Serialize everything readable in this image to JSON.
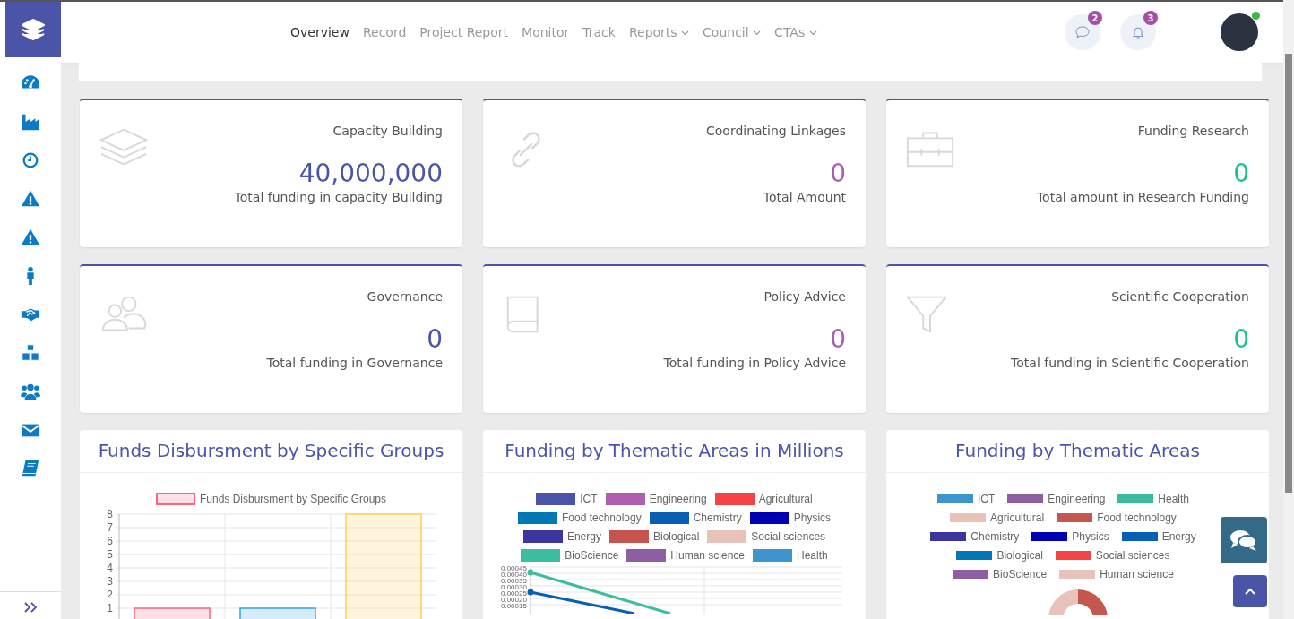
{
  "nav": {
    "items": [
      {
        "label": "Overview",
        "selected": true,
        "dropdown": false
      },
      {
        "label": "Record",
        "selected": false,
        "dropdown": false
      },
      {
        "label": "Project Report",
        "selected": false,
        "dropdown": false
      },
      {
        "label": "Monitor",
        "selected": false,
        "dropdown": false
      },
      {
        "label": "Track",
        "selected": false,
        "dropdown": false
      },
      {
        "label": "Reports",
        "selected": false,
        "dropdown": true
      },
      {
        "label": "Council",
        "selected": false,
        "dropdown": true
      },
      {
        "label": "CTAs",
        "selected": false,
        "dropdown": true
      }
    ],
    "messages_count": "2",
    "notifications_count": "3",
    "user_online": true
  },
  "sidebar": {
    "items": [
      {
        "kind": "gauge"
      },
      {
        "kind": "factory"
      },
      {
        "kind": "clock"
      },
      {
        "kind": "warning"
      },
      {
        "kind": "warning"
      },
      {
        "kind": "person"
      },
      {
        "kind": "handshake"
      },
      {
        "kind": "cubes"
      },
      {
        "kind": "users"
      },
      {
        "kind": "envelope"
      },
      {
        "kind": "book"
      }
    ]
  },
  "stats": [
    {
      "kind": "layers",
      "title": "Capacity Building",
      "value": "40,000,000",
      "caption": "Total funding in capacity Building",
      "color": "#4a55a8"
    },
    {
      "kind": "link",
      "title": "Coordinating Linkages",
      "value": "0",
      "caption": "Total Amount",
      "color": "#a95bb5"
    },
    {
      "kind": "briefcase",
      "title": "Funding Research",
      "value": "0",
      "caption": "Total amount in Research Funding",
      "color": "#1cbf8a"
    },
    {
      "kind": "users",
      "title": "Governance",
      "value": "0",
      "caption": "Total funding in Governance",
      "color": "#4a55a8"
    },
    {
      "kind": "book",
      "title": "Policy Advice",
      "value": "0",
      "caption": "Total funding in Policy Advice",
      "color": "#a95bb5"
    },
    {
      "kind": "funnel",
      "title": "Scientific Cooperation",
      "value": "0",
      "caption": "Total funding in Scientific Cooperation",
      "color": "#1cbf8a"
    }
  ],
  "charts": [
    {
      "kind": "bar",
      "title": "Funds Disbursment by Specific Groups",
      "chart_data": {
        "type": "bar",
        "yticks": [
          1,
          2,
          3,
          4,
          5,
          6,
          7,
          8
        ],
        "ylim": [
          0,
          8
        ],
        "grid": true,
        "series": [
          {
            "name": "Funds Disbursment by Specific Groups",
            "color": "#ff6384",
            "colors": [
              "#ff6384",
              "#36a2eb",
              "#ffce56"
            ],
            "values": [
              1,
              1,
              8
            ]
          }
        ]
      }
    },
    {
      "kind": "line",
      "title": "Funding by Thematic Areas in Millions",
      "legend": [
        {
          "label": "ICT",
          "color": "#4a55a8"
        },
        {
          "label": "Engineering",
          "color": "#b05fb0"
        },
        {
          "label": "Agricultural",
          "color": "#f54444"
        },
        {
          "label": "Food technology",
          "color": "#0277b5"
        },
        {
          "label": "Chemistry",
          "color": "#085fb3"
        },
        {
          "label": "Physics",
          "color": "#0000b3"
        },
        {
          "label": "Energy",
          "color": "#3c35a0"
        },
        {
          "label": "Biological",
          "color": "#c5544f"
        },
        {
          "label": "Social sciences",
          "color": "#e8c3b9"
        },
        {
          "label": "BioScience",
          "color": "#3bbd9f"
        },
        {
          "label": "Human science",
          "color": "#8e5ea2"
        },
        {
          "label": "Health",
          "color": "#3e95cd"
        }
      ],
      "y_axis_labels": [
        "0.00045",
        "0.00040",
        "0.00035",
        "0.00030",
        "0.00025",
        "0.00020",
        "0.00015"
      ]
    },
    {
      "kind": "donut",
      "title": "Funding by Thematic Areas",
      "legend": [
        {
          "label": "ICT",
          "color": "#3e95cd"
        },
        {
          "label": "Engineering",
          "color": "#8e5ea2"
        },
        {
          "label": "Health",
          "color": "#3cba9f"
        },
        {
          "label": "Agricultural",
          "color": "#e8c3b9"
        },
        {
          "label": "Food technology",
          "color": "#c45850"
        },
        {
          "label": "Chemistry",
          "color": "#3c35a0"
        },
        {
          "label": "Physics",
          "color": "#0000b3"
        },
        {
          "label": "Energy",
          "color": "#085fb3"
        },
        {
          "label": "Biological",
          "color": "#0277b5"
        },
        {
          "label": "Social sciences",
          "color": "#f54444"
        },
        {
          "label": "BioScience",
          "color": "#8e5ea2"
        },
        {
          "label": "Human science",
          "color": "#e8c3b9"
        }
      ]
    }
  ]
}
